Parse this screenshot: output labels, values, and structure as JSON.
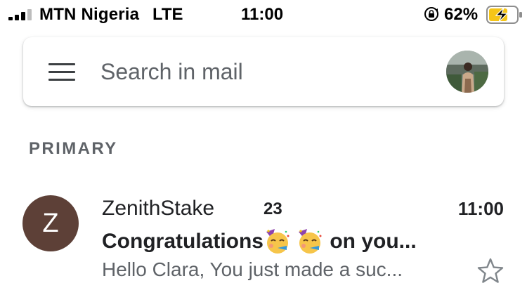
{
  "status_bar": {
    "carrier": "MTN Nigeria",
    "network": "LTE",
    "time": "11:00",
    "battery_percent": "62%",
    "icons": [
      "signal-icon",
      "rotation-lock-icon",
      "battery-charging-icon"
    ]
  },
  "search": {
    "placeholder": "Search in mail",
    "menu_icon": "hamburger-menu-icon",
    "account_avatar": "account-avatar-photo"
  },
  "section": {
    "label": "PRIMARY"
  },
  "mail_list": [
    {
      "avatar_letter": "Z",
      "avatar_color": "#5d4037",
      "sender": "ZenithStake",
      "thread_count": "23",
      "time": "11:00",
      "subject_start": "Congratulations",
      "subject_emojis": [
        "partying-face",
        "partying-face"
      ],
      "subject_end": " on you...",
      "snippet": "Hello Clara, You just made a suc...",
      "starred": false
    }
  ],
  "colors": {
    "accent_text": "#202124",
    "secondary_text": "#5f6368",
    "battery_fill": "#f5c518"
  }
}
